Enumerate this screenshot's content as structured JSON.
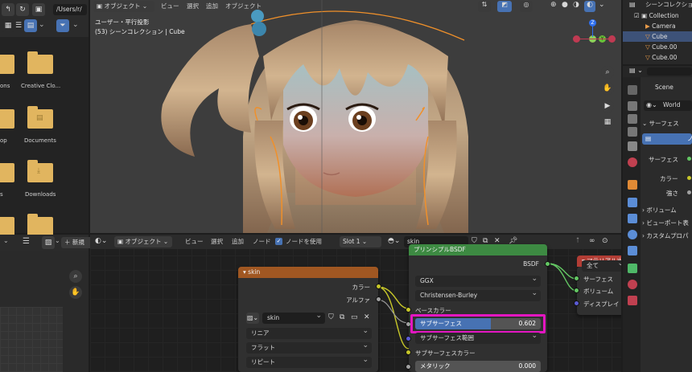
{
  "file_browser": {
    "path": "/Users/r/",
    "items": [
      {
        "label": "ons",
        "icon": "folder-icon"
      },
      {
        "label": "Creative Clo...",
        "icon": "folder-icon"
      },
      {
        "label": "op",
        "icon": "folder-icon"
      },
      {
        "label": "Documents",
        "icon": "folder-documents-icon"
      },
      {
        "label": "s",
        "icon": "folder-icon"
      },
      {
        "label": "Downloads",
        "icon": "folder-download-icon"
      }
    ],
    "new_label": "新規"
  },
  "viewport": {
    "mode": "オブジェクト",
    "menus": [
      "ビュー",
      "選択",
      "追加",
      "オブジェクト"
    ],
    "view_label": "ユーザー・平行投影",
    "collection_label": "(53) シーンコレクション | Cube",
    "gizmo_z": "Z",
    "gizmo_y": "Y"
  },
  "outliner": {
    "title": "シーンコレクション",
    "rows": [
      "Collection",
      "Camera",
      "Cube",
      "Cube.00",
      "Cube.00"
    ]
  },
  "properties": {
    "scene_label": "Scene",
    "world_label": "World",
    "surface_header": "サーフェス",
    "use_nodes_btn": "ノ",
    "surface_label": "サーフェス",
    "color_label": "カラー",
    "strength_label": "強さ",
    "sections": [
      "ボリューム",
      "ビューポート表",
      "カスタムプロパ"
    ]
  },
  "node_editor": {
    "mode": "オブジェクト",
    "menus": [
      "ビュー",
      "選択",
      "追加",
      "ノード"
    ],
    "use_nodes_label": "ノードを使用",
    "slot": "Slot 1",
    "material": "skin"
  },
  "image_node": {
    "title": "skin",
    "output_color": "カラー",
    "output_alpha": "アルファ",
    "image_name": "skin",
    "interpolation": "リニア",
    "projection": "フラット",
    "extension": "リピート"
  },
  "bsdf_node": {
    "title": "プリンシプルBSDF",
    "output_bsdf": "BSDF",
    "distribution": "GGX",
    "subsurface_method": "Christensen-Burley",
    "base_color": "ベースカラー",
    "subsurface": "サブサーフェス",
    "subsurface_value": "0.602",
    "subsurface_value_fraction": 0.602,
    "subsurface_radius": "サブサーフェス範囲",
    "subsurface_color": "サブサーフェスカラー",
    "metallic": "メタリック",
    "metallic_value": "0.000"
  },
  "output_node": {
    "title": "マテリアル出力",
    "target": "全て",
    "surface": "サーフェス",
    "volume": "ボリューム",
    "displacement": "ディスプレイ"
  },
  "colors": {
    "accent_blue": "#4772b3",
    "highlight": "#e316c1",
    "image_header": "#a05722",
    "shader_header": "#3d8a42",
    "output_header": "#b23d35",
    "folder": "#e1b55f"
  }
}
